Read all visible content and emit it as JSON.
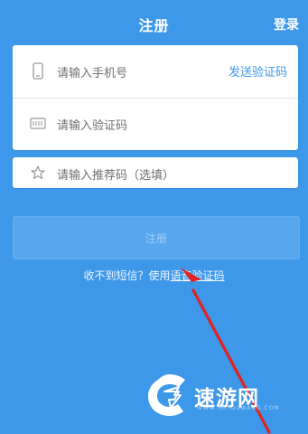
{
  "header": {
    "title": "注册",
    "login_label": "登录"
  },
  "form": {
    "phone_placeholder": "请输入手机号",
    "send_code_label": "发送验证码",
    "verification_placeholder": "请输入验证码",
    "referral_placeholder": "请输入推荐码（选填）"
  },
  "actions": {
    "register_label": "注册",
    "sms_help_prefix": "收不到短信？使用",
    "voice_code_link": "语音验证码"
  },
  "icons": {
    "phone": "phone-icon",
    "verification": "verification-code-icon",
    "referral": "star-icon",
    "pointer": "red-arrow-icon"
  },
  "colors": {
    "background": "#3d98ea",
    "card": "#ffffff",
    "accent": "#3d98ea",
    "arrow": "#e02323"
  },
  "watermark": {
    "text": "速游网",
    "subtext": "WWW.SUYOUWANG.COM"
  }
}
